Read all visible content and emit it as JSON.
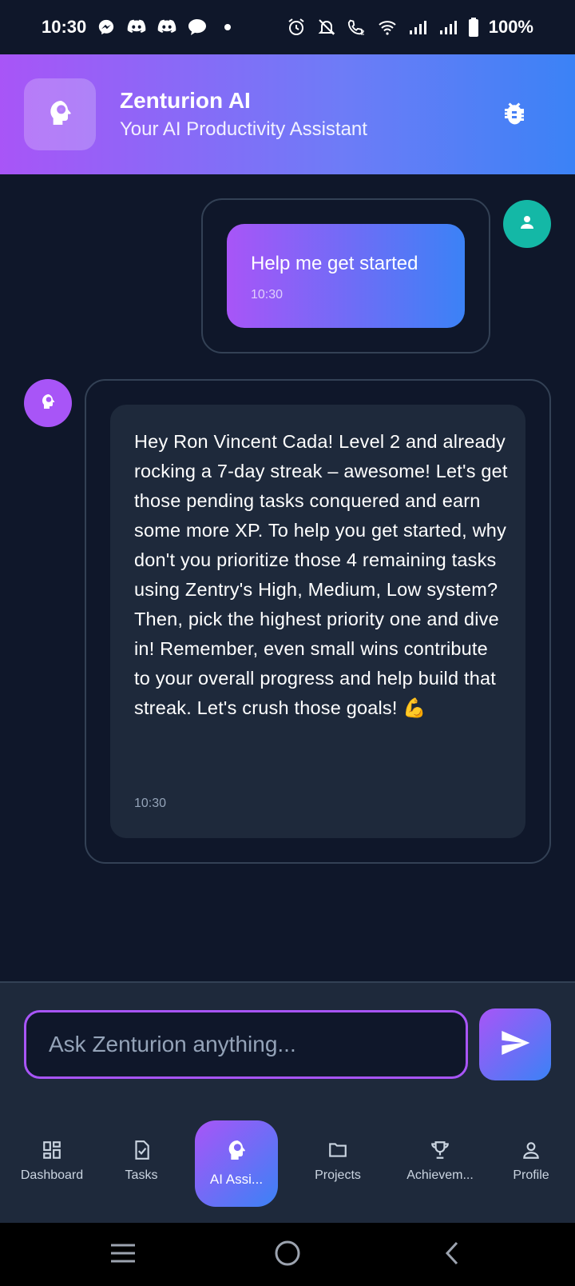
{
  "status_bar": {
    "time": "10:30",
    "battery": "100%",
    "left_icons": [
      "messenger-icon",
      "discord-icon",
      "discord-icon",
      "chat-bubble-icon",
      "dot-icon"
    ],
    "right_icons": [
      "alarm-icon",
      "mute-icon",
      "wifi-calling-icon",
      "wifi-icon",
      "signal-icon",
      "signal-icon",
      "battery-icon"
    ]
  },
  "header": {
    "title": "Zenturion AI",
    "subtitle": "Your AI Productivity Assistant",
    "logo_icon": "brain-head-icon",
    "action_icon": "bug-icon"
  },
  "messages": [
    {
      "sender": "user",
      "text": "Help me get started",
      "time": "10:30",
      "avatar_icon": "person-icon"
    },
    {
      "sender": "assistant",
      "text": "Hey Ron Vincent Cada! Level 2 and already rocking a 7-day streak – awesome!  Let's get those pending tasks conquered and earn some more XP.  To help you get started, why don't you prioritize those 4 remaining tasks using Zentry's High, Medium, Low system?  Then, pick the highest priority one and dive in! Remember, even small wins contribute to your overall progress and help build that streak. Let's crush those goals!  💪",
      "time": "10:30",
      "avatar_icon": "brain-head-icon"
    }
  ],
  "composer": {
    "placeholder": "Ask Zenturion anything...",
    "value": "",
    "send_icon": "send-icon"
  },
  "bottom_nav": {
    "items": [
      {
        "label": "Dashboard",
        "icon": "dashboard-icon",
        "active": false
      },
      {
        "label": "Tasks",
        "icon": "task-check-icon",
        "active": false
      },
      {
        "label": "AI Assi...",
        "icon": "brain-head-icon",
        "active": true
      },
      {
        "label": "Projects",
        "icon": "folder-icon",
        "active": false
      },
      {
        "label": "Achievem...",
        "icon": "trophy-icon",
        "active": false
      },
      {
        "label": "Profile",
        "icon": "person-icon",
        "active": false
      }
    ]
  },
  "system_nav": [
    "menu-icon",
    "home-icon",
    "back-icon"
  ],
  "colors": {
    "background": "#0f172a",
    "surface": "#1e293b",
    "border": "#334155",
    "accent_purple": "#a855f7",
    "accent_blue": "#3b82f6",
    "user_avatar": "#14b8a6"
  }
}
